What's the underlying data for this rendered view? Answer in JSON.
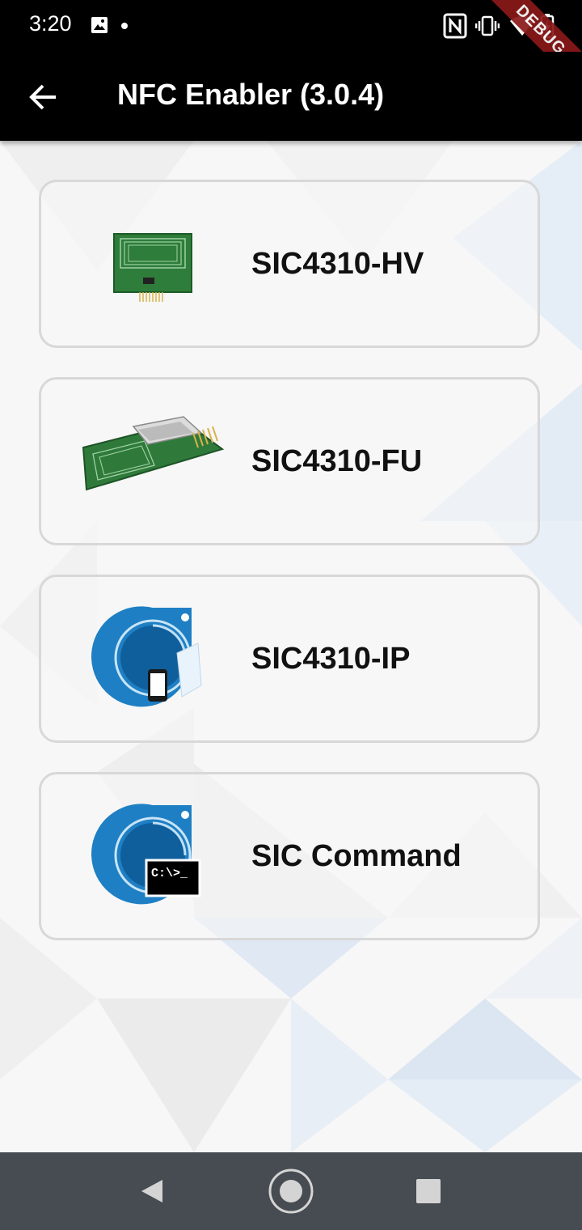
{
  "status_bar": {
    "time": "3:20",
    "icons": [
      "image-icon",
      "notification-dot",
      "nfc-icon",
      "vibrate-icon",
      "wifi-icon",
      "battery-icon"
    ],
    "debug_banner": "DEBUG"
  },
  "app_bar": {
    "title": "NFC Enabler (3.0.4)",
    "back_icon": "arrow-left-icon"
  },
  "devices": [
    {
      "label": "SIC4310-HV",
      "image": "green-nfc-board-hv"
    },
    {
      "label": "SIC4310-FU",
      "image": "green-nfc-board-fu"
    },
    {
      "label": "SIC4310-IP",
      "image": "blue-nfc-logo-phone"
    },
    {
      "label": "SIC Command",
      "image": "blue-nfc-logo-terminal",
      "terminal_text": "C:\\>_"
    }
  ],
  "nav_bar": {
    "buttons": [
      "back-triangle-icon",
      "home-circle-icon",
      "recents-square-icon"
    ]
  },
  "colors": {
    "app_bar": "#000000",
    "nav_bar": "#474c52",
    "card_border": "#d8d8d8",
    "logo_blue": "#1e7fc4",
    "board_green": "#2f7a3a",
    "debug_red": "#8b1a1a"
  }
}
